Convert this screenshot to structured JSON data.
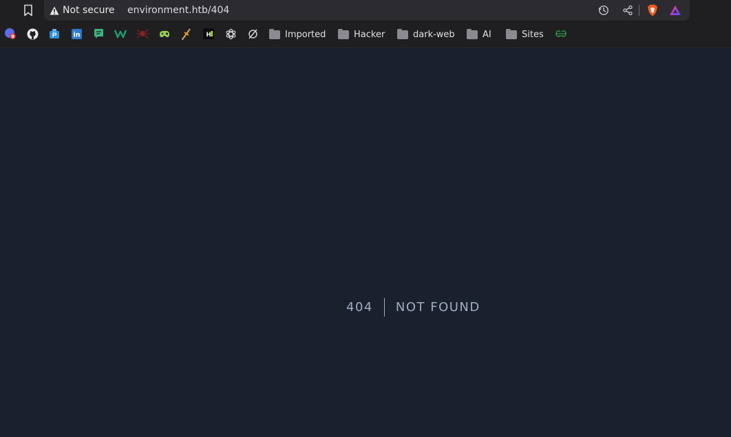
{
  "browser": {
    "security_label": "Not secure",
    "url": "environment.htb/404"
  },
  "bookmarks": {
    "icons": [
      {
        "name": "mail-icon",
        "color": "#6d7cf7"
      },
      {
        "name": "github-icon",
        "color": "#e0e0e4"
      },
      {
        "name": "playstation-icon",
        "color": "#2f8fd6"
      },
      {
        "name": "linkedin-icon",
        "color": "#2f7ac8"
      },
      {
        "name": "chat-icon",
        "color": "#3fb27f"
      },
      {
        "name": "w-icon",
        "color": "#1f9f6f"
      },
      {
        "name": "spider-icon",
        "color": "#8a2222"
      },
      {
        "name": "game-icon",
        "color": "#9bd24a"
      },
      {
        "name": "sword-icon",
        "color": "#e6a235"
      },
      {
        "name": "hackthebox-icon",
        "color": "#e0e0e4"
      },
      {
        "name": "openai-icon",
        "color": "#d0d0d4"
      },
      {
        "name": "ring-icon",
        "color": "#d0d0d4"
      }
    ],
    "folders": [
      "Imported",
      "Hacker",
      "dark-web",
      "AI",
      "Sites"
    ],
    "trailing_icon": {
      "name": "geeksforgeeks-icon",
      "color": "#2f8d46"
    }
  },
  "page": {
    "code": "404",
    "message": "NOT FOUND"
  },
  "colors": {
    "page_bg": "#1a202c",
    "text": "#a0aec0"
  }
}
